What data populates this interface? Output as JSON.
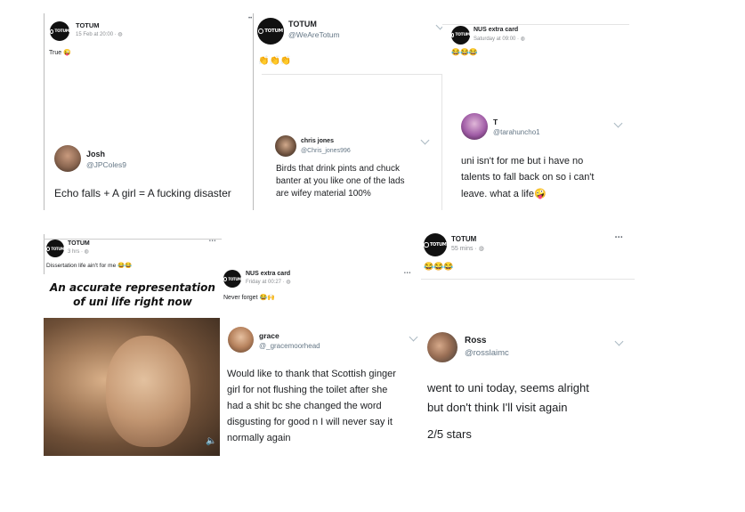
{
  "p1": {
    "page_name": "TOTUM",
    "logo_text": "TOTUM",
    "meta": "15 Feb at 20:00 · ",
    "post_text": "True",
    "post_emoji": "😜",
    "tweet_name": "Josh",
    "tweet_handle": "@JPColes9",
    "tweet_text": "Echo falls + A girl = A fucking disaster"
  },
  "p2": {
    "name": "TOTUM",
    "handle": "@WeAreTotum",
    "logo_text": "TOTUM",
    "emoji": "👏👏👏",
    "tweet_name": "chris jones",
    "tweet_handle": "@Chris_jones996",
    "tweet_lines": [
      "Birds that drink pints and chuck",
      "banter at you like one of the lads",
      "are wifey material 100%"
    ]
  },
  "p3": {
    "page_name": "NUS extra card",
    "logo_text": "TOTUM",
    "meta": "Saturday at 09:00 · ",
    "emoji": "😂😂😂",
    "tweet_name": "T",
    "tweet_handle": "@tarahuncho1",
    "tweet_lines": [
      "uni isn't for me but i have no",
      "talents to fall back on so i can't",
      "leave. what a life"
    ],
    "tweet_emoji": "🤪"
  },
  "p4": {
    "page_name": "TOTUM",
    "logo_text": "TOTUM",
    "meta": "3 hrs · ",
    "more": "•••",
    "post_text": "Dissertation life ain't for me",
    "post_emoji": "😂😂",
    "caption_lines": [
      "An accurate representation",
      "of uni life right now"
    ],
    "speaker_icon": "🔈"
  },
  "p5": {
    "page_name": "NUS extra card",
    "logo_text": "TOTUM",
    "meta": "Friday at 00:27 · ",
    "more": "•••",
    "post_text": "Never forget",
    "post_emoji": "😂🙌",
    "tweet_name": "grace",
    "tweet_handle": "@_gracemoorhead",
    "tweet_lines": [
      "Would like to thank that Scottish ginger",
      "girl for not flushing the toilet after she",
      "had a shit bc she changed the word",
      "disgusting for good n I will never say it",
      "normally again"
    ]
  },
  "p6": {
    "page_name": "TOTUM",
    "logo_text": "TOTUM",
    "meta": "55 mins · ",
    "more": "•••",
    "emoji": "😂😂😂",
    "tweet_name": "Ross",
    "tweet_handle": "@rosslaimc",
    "tweet_lines": [
      "went to uni today, seems alright",
      "but don't think I'll visit again"
    ],
    "tweet_rating": "2/5 stars"
  },
  "colors": {
    "link_gray": "#8a8d91",
    "logo_bg": "#111111",
    "handle_blue": "#657786"
  }
}
